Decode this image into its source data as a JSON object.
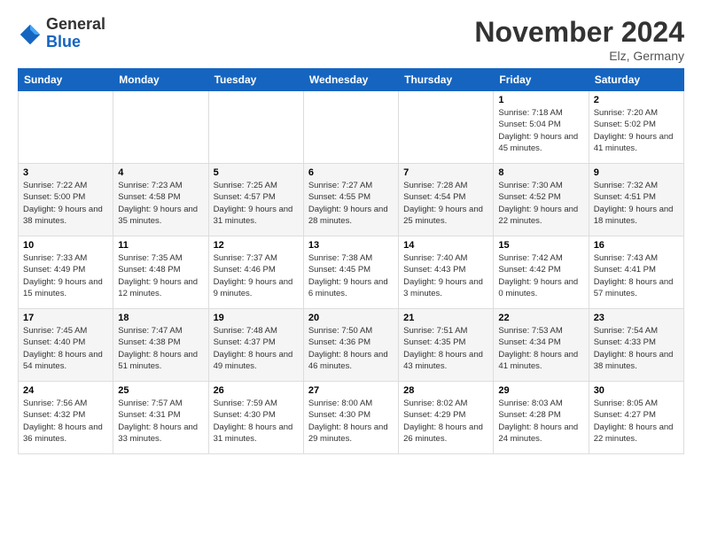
{
  "header": {
    "logo_general": "General",
    "logo_blue": "Blue",
    "month_title": "November 2024",
    "location": "Elz, Germany"
  },
  "days_of_week": [
    "Sunday",
    "Monday",
    "Tuesday",
    "Wednesday",
    "Thursday",
    "Friday",
    "Saturday"
  ],
  "weeks": [
    [
      {
        "day": "",
        "info": ""
      },
      {
        "day": "",
        "info": ""
      },
      {
        "day": "",
        "info": ""
      },
      {
        "day": "",
        "info": ""
      },
      {
        "day": "",
        "info": ""
      },
      {
        "day": "1",
        "info": "Sunrise: 7:18 AM\nSunset: 5:04 PM\nDaylight: 9 hours and 45 minutes."
      },
      {
        "day": "2",
        "info": "Sunrise: 7:20 AM\nSunset: 5:02 PM\nDaylight: 9 hours and 41 minutes."
      }
    ],
    [
      {
        "day": "3",
        "info": "Sunrise: 7:22 AM\nSunset: 5:00 PM\nDaylight: 9 hours and 38 minutes."
      },
      {
        "day": "4",
        "info": "Sunrise: 7:23 AM\nSunset: 4:58 PM\nDaylight: 9 hours and 35 minutes."
      },
      {
        "day": "5",
        "info": "Sunrise: 7:25 AM\nSunset: 4:57 PM\nDaylight: 9 hours and 31 minutes."
      },
      {
        "day": "6",
        "info": "Sunrise: 7:27 AM\nSunset: 4:55 PM\nDaylight: 9 hours and 28 minutes."
      },
      {
        "day": "7",
        "info": "Sunrise: 7:28 AM\nSunset: 4:54 PM\nDaylight: 9 hours and 25 minutes."
      },
      {
        "day": "8",
        "info": "Sunrise: 7:30 AM\nSunset: 4:52 PM\nDaylight: 9 hours and 22 minutes."
      },
      {
        "day": "9",
        "info": "Sunrise: 7:32 AM\nSunset: 4:51 PM\nDaylight: 9 hours and 18 minutes."
      }
    ],
    [
      {
        "day": "10",
        "info": "Sunrise: 7:33 AM\nSunset: 4:49 PM\nDaylight: 9 hours and 15 minutes."
      },
      {
        "day": "11",
        "info": "Sunrise: 7:35 AM\nSunset: 4:48 PM\nDaylight: 9 hours and 12 minutes."
      },
      {
        "day": "12",
        "info": "Sunrise: 7:37 AM\nSunset: 4:46 PM\nDaylight: 9 hours and 9 minutes."
      },
      {
        "day": "13",
        "info": "Sunrise: 7:38 AM\nSunset: 4:45 PM\nDaylight: 9 hours and 6 minutes."
      },
      {
        "day": "14",
        "info": "Sunrise: 7:40 AM\nSunset: 4:43 PM\nDaylight: 9 hours and 3 minutes."
      },
      {
        "day": "15",
        "info": "Sunrise: 7:42 AM\nSunset: 4:42 PM\nDaylight: 9 hours and 0 minutes."
      },
      {
        "day": "16",
        "info": "Sunrise: 7:43 AM\nSunset: 4:41 PM\nDaylight: 8 hours and 57 minutes."
      }
    ],
    [
      {
        "day": "17",
        "info": "Sunrise: 7:45 AM\nSunset: 4:40 PM\nDaylight: 8 hours and 54 minutes."
      },
      {
        "day": "18",
        "info": "Sunrise: 7:47 AM\nSunset: 4:38 PM\nDaylight: 8 hours and 51 minutes."
      },
      {
        "day": "19",
        "info": "Sunrise: 7:48 AM\nSunset: 4:37 PM\nDaylight: 8 hours and 49 minutes."
      },
      {
        "day": "20",
        "info": "Sunrise: 7:50 AM\nSunset: 4:36 PM\nDaylight: 8 hours and 46 minutes."
      },
      {
        "day": "21",
        "info": "Sunrise: 7:51 AM\nSunset: 4:35 PM\nDaylight: 8 hours and 43 minutes."
      },
      {
        "day": "22",
        "info": "Sunrise: 7:53 AM\nSunset: 4:34 PM\nDaylight: 8 hours and 41 minutes."
      },
      {
        "day": "23",
        "info": "Sunrise: 7:54 AM\nSunset: 4:33 PM\nDaylight: 8 hours and 38 minutes."
      }
    ],
    [
      {
        "day": "24",
        "info": "Sunrise: 7:56 AM\nSunset: 4:32 PM\nDaylight: 8 hours and 36 minutes."
      },
      {
        "day": "25",
        "info": "Sunrise: 7:57 AM\nSunset: 4:31 PM\nDaylight: 8 hours and 33 minutes."
      },
      {
        "day": "26",
        "info": "Sunrise: 7:59 AM\nSunset: 4:30 PM\nDaylight: 8 hours and 31 minutes."
      },
      {
        "day": "27",
        "info": "Sunrise: 8:00 AM\nSunset: 4:30 PM\nDaylight: 8 hours and 29 minutes."
      },
      {
        "day": "28",
        "info": "Sunrise: 8:02 AM\nSunset: 4:29 PM\nDaylight: 8 hours and 26 minutes."
      },
      {
        "day": "29",
        "info": "Sunrise: 8:03 AM\nSunset: 4:28 PM\nDaylight: 8 hours and 24 minutes."
      },
      {
        "day": "30",
        "info": "Sunrise: 8:05 AM\nSunset: 4:27 PM\nDaylight: 8 hours and 22 minutes."
      }
    ]
  ]
}
